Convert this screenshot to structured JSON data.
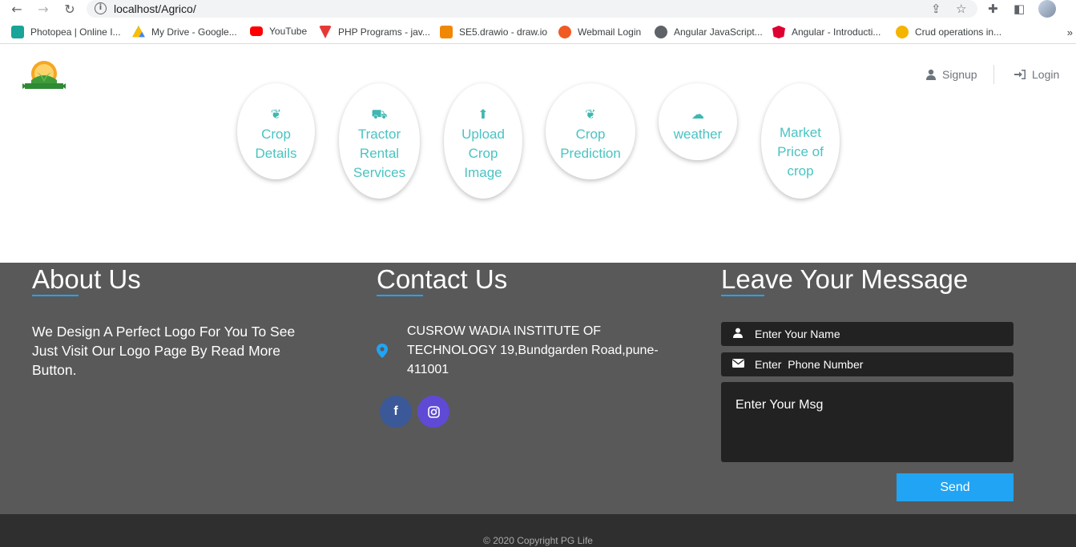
{
  "browser": {
    "url": "localhost/Agrico/",
    "bookmarks": [
      {
        "label": "Photopea | Online I...",
        "color": "#18a497"
      },
      {
        "label": "My Drive - Google...",
        "color": "#fbbc04"
      },
      {
        "label": "YouTube",
        "color": "#ff0000"
      },
      {
        "label": "PHP Programs - jav...",
        "color": "#e53935"
      },
      {
        "label": "SE5.drawio - draw.io",
        "color": "#f08705"
      },
      {
        "label": "Webmail Login",
        "color": "#f15a22"
      },
      {
        "label": "Angular JavaScript...",
        "color": "#5f6368"
      },
      {
        "label": "Angular - Introducti...",
        "color": "#dd0031"
      },
      {
        "label": "Crud operations in...",
        "color": "#f4b400"
      }
    ],
    "more": "»"
  },
  "header": {
    "signup": "Signup",
    "login": "Login"
  },
  "services": [
    {
      "lines": [
        "Crop",
        "Details"
      ],
      "icon": "sprout-icon"
    },
    {
      "lines": [
        "Tractor",
        "Rental",
        "Services"
      ],
      "icon": "tractor-icon"
    },
    {
      "lines": [
        "Upload",
        "Crop",
        "Image"
      ],
      "icon": "upload-icon"
    },
    {
      "lines": [
        "Crop",
        "Prediction"
      ],
      "icon": "sprout-icon"
    },
    {
      "lines": [
        "weather"
      ],
      "icon": "cloud-icon"
    },
    {
      "lines": [
        "Market",
        "Price of",
        "crop"
      ],
      "icon": ""
    }
  ],
  "footer": {
    "about": {
      "title": "About Us",
      "text": "We Design A Perfect Logo For You To See Just Visit Our Logo Page By Read More Button."
    },
    "contact": {
      "title": "Contact Us",
      "address": "CUSROW WADIA INSTITUTE OF TECHNOLOGY 19,Bundgarden Road,pune-411001",
      "facebook": "f",
      "facebook_color": "#3b5998",
      "instagram_color": "#5f4ad6"
    },
    "message": {
      "title": "Leave Your Message",
      "name_placeholder": "Enter Your Name",
      "phone_placeholder": "Enter  Phone Number",
      "msg_placeholder": "Enter Your Msg",
      "send": "Send"
    },
    "accent": "#21a4f3",
    "copyright": "© 2020 Copyright PG Life"
  }
}
